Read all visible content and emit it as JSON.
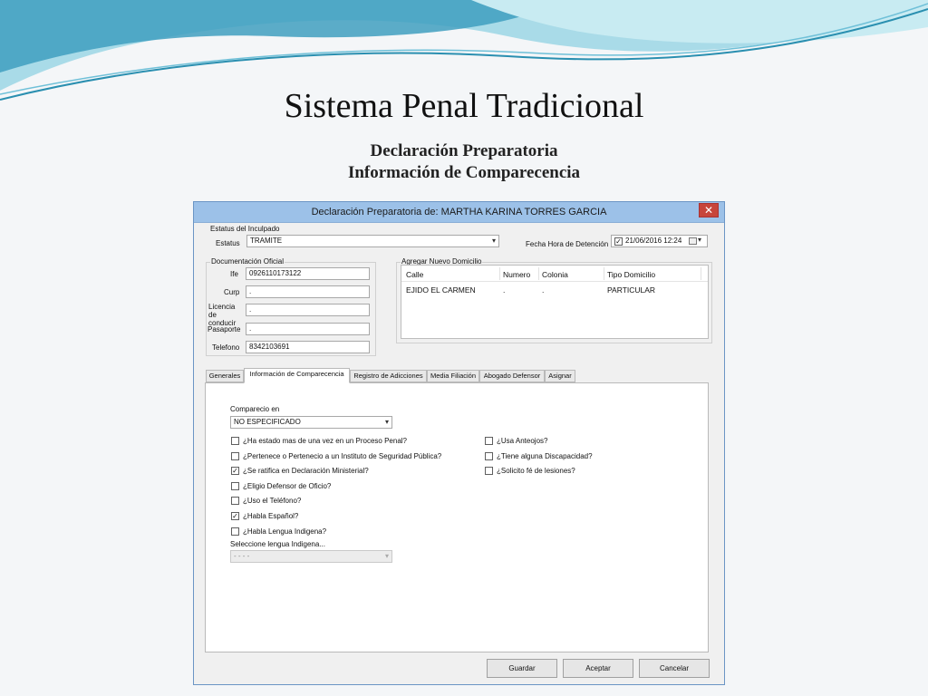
{
  "slide": {
    "title": "Sistema Penal Tradicional",
    "subtitle1": "Declaración Preparatoria",
    "subtitle2": "Información de Comparecencia"
  },
  "window": {
    "title": "Declaración Preparatoria de: MARTHA KARINA TORRES GARCIA",
    "close_glyph": "✕"
  },
  "status_group": {
    "label": "Estatus del Inculpado",
    "estatus_label": "Estatus",
    "estatus_value": "TRAMITE",
    "fecha_label": "Fecha Hora de Detención",
    "fecha_value": "21/06/2016 12:24",
    "fecha_checked": true
  },
  "documentacion": {
    "label": "Documentación Oficial",
    "fields": [
      {
        "label": "Ife",
        "value": "0926110173122"
      },
      {
        "label": "Curp",
        "value": "."
      },
      {
        "label": "Licencia de conducir",
        "value": "."
      },
      {
        "label": "Pasaporte",
        "value": "."
      },
      {
        "label": "Telefono",
        "value": "8342103691"
      }
    ]
  },
  "domicilio": {
    "link": "Agregar Nuevo Domicilio",
    "columns": [
      "Calle",
      "Numero",
      "Colonia",
      "Tipo Domicilio"
    ],
    "rows": [
      [
        "EJIDO EL CARMEN",
        ".",
        ".",
        "PARTICULAR"
      ]
    ]
  },
  "tabs": [
    "Generales",
    "Información de Comparecencia",
    "Registro de Adicciones",
    "Media Filiación",
    "Abogado Defensor",
    "Asignar"
  ],
  "active_tab": 1,
  "comparecencia": {
    "compareccio_label": "Comparecio en",
    "compareccio_value": "NO ESPECIFICADO",
    "left_checks": [
      {
        "label": "¿Ha estado mas de una vez en un Proceso Penal?",
        "checked": false
      },
      {
        "label": "¿Pertenece o Pertenecio a un Instituto de Seguridad Pública?",
        "checked": false
      },
      {
        "label": "¿Se ratifica en Declaración Ministerial?",
        "checked": true
      },
      {
        "label": "¿Eligio Defensor de Oficio?",
        "checked": false
      },
      {
        "label": "¿Uso el Teléfono?",
        "checked": false
      },
      {
        "label": "¿Habla Español?",
        "checked": true
      },
      {
        "label": "¿Habla Lengua Indigena?",
        "checked": false
      }
    ],
    "right_checks": [
      {
        "label": "¿Usa Anteojos?",
        "checked": false
      },
      {
        "label": "¿Tiene alguna Discapacidad?",
        "checked": false
      },
      {
        "label": "¿Solicito fé de lesiones?",
        "checked": false
      }
    ],
    "lengua_label": "Seleccione lengua Indigena...",
    "lengua_value": "- - - -"
  },
  "buttons": {
    "guardar": "Guardar",
    "aceptar": "Aceptar",
    "cancelar": "Cancelar"
  },
  "icons": {
    "dropdown": "▾",
    "check": "✓",
    "calendar": "calendar-icon"
  },
  "colors": {
    "titlebar": "#9cc1e8",
    "close": "#c7453b",
    "wave_dark": "#2a8fb0",
    "wave_light": "#a9dbe8"
  }
}
